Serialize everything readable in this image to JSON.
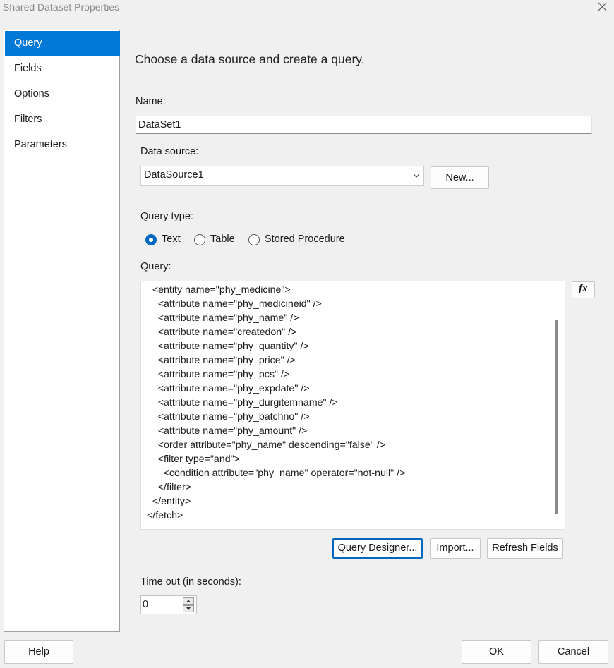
{
  "window": {
    "title": "Shared Dataset Properties",
    "close_icon": "close-icon"
  },
  "nav": {
    "items": [
      {
        "label": "Query",
        "selected": true
      },
      {
        "label": "Fields",
        "selected": false
      },
      {
        "label": "Options",
        "selected": false
      },
      {
        "label": "Filters",
        "selected": false
      },
      {
        "label": "Parameters",
        "selected": false
      }
    ]
  },
  "heading": "Choose a data source and create a query.",
  "name": {
    "label": "Name:",
    "value": "DataSet1"
  },
  "data_source": {
    "label": "Data source:",
    "value": "DataSource1",
    "new_button": "New..."
  },
  "query_type": {
    "label": "Query type:",
    "options": [
      {
        "label": "Text",
        "selected": true
      },
      {
        "label": "Table",
        "selected": false
      },
      {
        "label": "Stored Procedure",
        "selected": false
      }
    ]
  },
  "query": {
    "label": "Query:",
    "lines": [
      "  <entity name=\"phy_medicine\">",
      "    <attribute name=\"phy_medicineid\" />",
      "    <attribute name=\"phy_name\" />",
      "    <attribute name=\"createdon\" />",
      "    <attribute name=\"phy_quantity\" />",
      "    <attribute name=\"phy_price\" />",
      "    <attribute name=\"phy_pcs\" />",
      "    <attribute name=\"phy_expdate\" />",
      "    <attribute name=\"phy_durgitemname\" />",
      "    <attribute name=\"phy_batchno\" />",
      "    <attribute name=\"phy_amount\" />",
      "    <order attribute=\"phy_name\" descending=\"false\" />",
      "    <filter type=\"and\">",
      "      <condition attribute=\"phy_name\" operator=\"not-null\" />",
      "    </filter>",
      "  </entity>",
      "</fetch>"
    ],
    "fx_label": "fx"
  },
  "query_buttons": {
    "designer": "Query Designer...",
    "import": "Import...",
    "refresh": "Refresh Fields"
  },
  "timeout": {
    "label": "Time out (in seconds):",
    "value": "0"
  },
  "footer": {
    "help": "Help",
    "ok": "OK",
    "cancel": "Cancel"
  },
  "colors": {
    "selected": "#0078d7",
    "accent": "#0067c0"
  }
}
